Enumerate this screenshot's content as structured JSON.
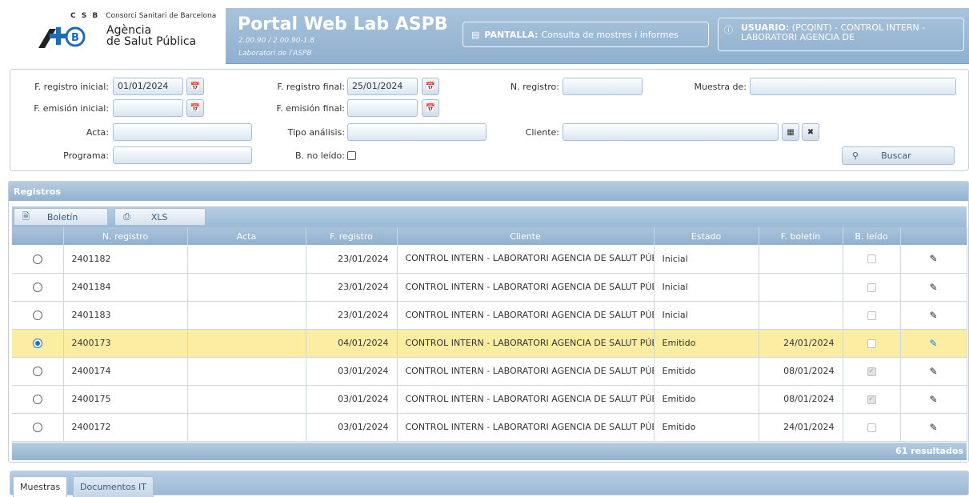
{
  "header": {
    "csb": "C S B",
    "consorci": "Consorci Sanitari de Barcelona",
    "agencia_line1": "Agència",
    "agencia_line2": "de Salut Pública",
    "portal_title": "Portal Web Lab ASPB",
    "version": "2.00.90 / 2.00.90-1.8",
    "subtitle": "Laboratori de l'ASPB",
    "pantalla_label": "PANTALLA:",
    "pantalla_value": "Consulta de mostres i informes",
    "usuario_label": "USUARIO:",
    "usuario_value": "(PCQINT) - CONTROL INTERN - LABORATORI AGENCIA DE"
  },
  "filters": {
    "f_registro_inicial_label": "F. registro inicial:",
    "f_registro_inicial_value": "01/01/2024",
    "f_registro_final_label": "F. registro final:",
    "f_registro_final_value": "25/01/2024",
    "n_registro_label": "N. registro:",
    "n_registro_value": "",
    "muestra_de_label": "Muestra de:",
    "muestra_de_value": "",
    "f_emision_inicial_label": "F. emisión inicial:",
    "f_emision_inicial_value": "",
    "f_emision_final_label": "F. emisión final:",
    "f_emision_final_value": "",
    "acta_label": "Acta:",
    "acta_value": "",
    "tipo_analisis_label": "Tipo análisis:",
    "tipo_analisis_value": "",
    "cliente_label": "Cliente:",
    "cliente_value": "",
    "programa_label": "Programa:",
    "programa_value": "",
    "b_no_leido_label": "B. no leído:",
    "buscar_label": "Buscar"
  },
  "registros": {
    "title": "Registros",
    "boletin_label": "Boletín",
    "xls_label": "XLS",
    "columns": [
      "",
      "N. registro",
      "Acta",
      "F. registro",
      "Cliente",
      "Estado",
      "F. boletín",
      "B. leído",
      ""
    ],
    "rows": [
      {
        "n_registro": "2401182",
        "acta": "",
        "f_registro": "23/01/2024",
        "cliente": "CONTROL INTERN - LABORATORI AGENCIA DE SALUT PÚBLI",
        "estado": "Inicial",
        "f_boletin": "",
        "b_leido": false,
        "selected": false
      },
      {
        "n_registro": "2401184",
        "acta": "",
        "f_registro": "23/01/2024",
        "cliente": "CONTROL INTERN - LABORATORI AGENCIA DE SALUT PÚBLI",
        "estado": "Inicial",
        "f_boletin": "",
        "b_leido": false,
        "selected": false
      },
      {
        "n_registro": "2401183",
        "acta": "",
        "f_registro": "23/01/2024",
        "cliente": "CONTROL INTERN - LABORATORI AGENCIA DE SALUT PÚBLI",
        "estado": "Inicial",
        "f_boletin": "",
        "b_leido": false,
        "selected": false
      },
      {
        "n_registro": "2400173",
        "acta": "",
        "f_registro": "04/01/2024",
        "cliente": "CONTROL INTERN - LABORATORI AGENCIA DE SALUT PÚBLI",
        "estado": "Emitido",
        "f_boletin": "24/01/2024",
        "b_leido": false,
        "selected": true
      },
      {
        "n_registro": "2400174",
        "acta": "",
        "f_registro": "03/01/2024",
        "cliente": "CONTROL INTERN - LABORATORI AGENCIA DE SALUT PÚBLI",
        "estado": "Emitido",
        "f_boletin": "08/01/2024",
        "b_leido": true,
        "selected": false
      },
      {
        "n_registro": "2400175",
        "acta": "",
        "f_registro": "03/01/2024",
        "cliente": "CONTROL INTERN - LABORATORI AGENCIA DE SALUT PÚBLI",
        "estado": "Emitido",
        "f_boletin": "08/01/2024",
        "b_leido": true,
        "selected": false
      },
      {
        "n_registro": "2400172",
        "acta": "",
        "f_registro": "03/01/2024",
        "cliente": "CONTROL INTERN - LABORATORI AGENCIA DE SALUT PÚBLI",
        "estado": "Emitido",
        "f_boletin": "24/01/2024",
        "b_leido": false,
        "selected": false
      }
    ],
    "result_count": "61 resultados"
  },
  "tabs": [
    {
      "label": "Muestras",
      "active": true
    },
    {
      "label": "Documentos IT",
      "active": false
    }
  ],
  "colors": {
    "header_blue": "#8fb0cf",
    "selected_row": "#fbeda1",
    "radio_selected": "#1a6fd8"
  },
  "icons": {
    "calendar": "calendar-icon",
    "search": "search-icon",
    "edit": "pencil-icon",
    "clear": "close-icon"
  }
}
